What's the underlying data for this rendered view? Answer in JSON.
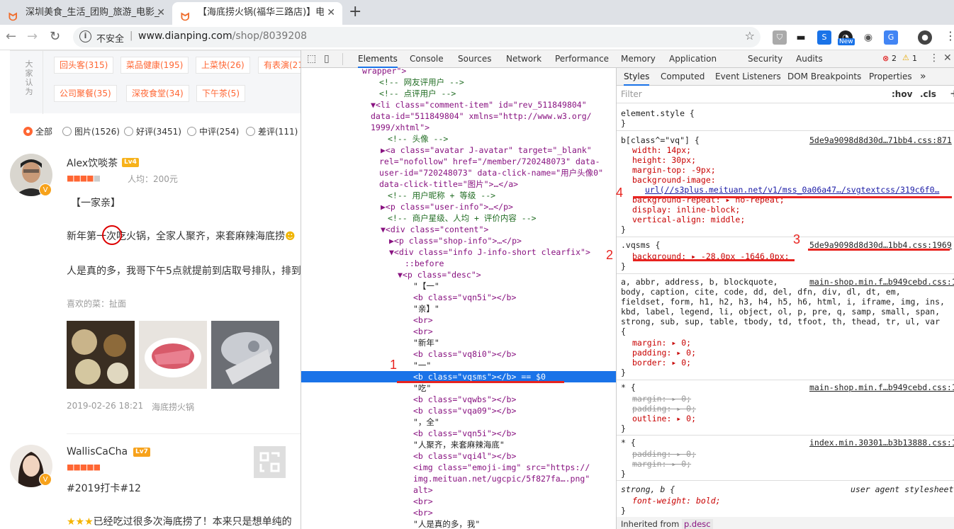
{
  "tabs": [
    {
      "title": "深圳美食_生活_团购_旅游_电影_",
      "active": false
    },
    {
      "title": "【海底捞火锅(福华三路店)】电话",
      "active": true
    }
  ],
  "address": {
    "security": "不安全",
    "host": "www.dianping.com",
    "path": "/shop/8039208"
  },
  "ext_badge": "New",
  "page": {
    "tag_label": "大家认为",
    "tags": [
      "回头客(315)",
      "菜品健康(195)",
      "上菜快(26)",
      "有表演(21",
      "公司聚餐(35)",
      "深夜食堂(34)",
      "下午茶(5)"
    ],
    "filters": [
      "全部",
      "图片(1526)",
      "好评(3451)",
      "中评(254)",
      "差评(111)"
    ],
    "review1": {
      "user": "Alex饮啖茶",
      "level": "Lv4",
      "avg": "人均：200元",
      "title": "【一家亲】",
      "line1a": "新年第一",
      "line1b": "次",
      "line1c": "吃火锅，全家人聚齐，来套麻辣海底捞",
      "line2": "人是真的多，我哥下午5点就提前到店取号排队，排到",
      "likes": "喜欢的菜：扯面",
      "date": "2019-02-26 18:21",
      "shop": "海底捞火锅"
    },
    "review2": {
      "user": "WallisCaCha",
      "level": "Lv7",
      "title": "#2019打卡#12",
      "line1": "已经吃过很多次海底捞了！本来只是想单纯的"
    }
  },
  "devtools": {
    "tabs": [
      "Elements",
      "Console",
      "Sources",
      "Network",
      "Performance",
      "Memory",
      "Application",
      "Security",
      "Audits"
    ],
    "errors": "2",
    "warnings": "1",
    "style_tabs": [
      "Styles",
      "Computed",
      "Event Listeners",
      "DOM Breakpoints",
      "Properties"
    ],
    "filter_placeholder": "Filter",
    "hov": ":hov",
    "cls": ".cls",
    "dom": [
      [
        "wrapper\">",
        ""
      ],
      [
        "<!-- 网友评用户 -->",
        "c"
      ],
      [
        "<!-- 点评用户 -->",
        "c"
      ],
      [
        "▼<li class=\"comment-item\" id=\"rev_511849804\"",
        ""
      ],
      [
        "data-id=\"511849804\" xmlns=\"http://www.w3.org/",
        ""
      ],
      [
        "1999/xhtml\">",
        ""
      ],
      [
        "<!-- 头像 -->",
        "c"
      ],
      [
        "▶<a class=\"avatar J-avatar\" target=\"_blank\"",
        ""
      ],
      [
        "rel=\"nofollow\" href=\"/member/720248073\" data-",
        ""
      ],
      [
        "user-id=\"720248073\" data-click-name=\"用户头像0\"",
        ""
      ],
      [
        "data-click-title=\"图片\">…</a>",
        ""
      ],
      [
        "<!-- 用户昵称 + 等级 -->",
        "c"
      ],
      [
        "▶<p class=\"user-info\">…</p>",
        ""
      ],
      [
        "<!-- 商户星级、人均 + 评价内容 -->",
        "c"
      ],
      [
        "▼<div class=\"content\">",
        ""
      ],
      [
        "▶<p class=\"shop-info\">…</p>",
        ""
      ],
      [
        "▼<div class=\"info J-info-short clearfix\">",
        ""
      ],
      [
        "::before",
        ""
      ],
      [
        "▼<p class=\"desc\">",
        ""
      ],
      [
        "\"【一\"",
        "t"
      ],
      [
        "<b class=\"vqn5i\"></b>",
        ""
      ],
      [
        "\"亲】\"",
        "t"
      ],
      [
        "<br>",
        ""
      ],
      [
        "<br>",
        ""
      ],
      [
        "\"新年\"",
        "t"
      ],
      [
        "<b class=\"vq8i0\"></b>",
        ""
      ],
      [
        "\"一\"",
        "t"
      ],
      [
        "<b class=\"vqsms\"></b> == $0",
        "s"
      ],
      [
        "\"吃\"",
        "t"
      ],
      [
        "<b class=\"vqwbs\"></b>",
        ""
      ],
      [
        "<b class=\"vqa09\"></b>",
        ""
      ],
      [
        "\"，全\"",
        "t"
      ],
      [
        "<b class=\"vqn5i\"></b>",
        ""
      ],
      [
        "\"人聚齐，来套麻辣海底\"",
        "t"
      ],
      [
        "<b class=\"vqi4l\"></b>",
        ""
      ],
      [
        "<img class=\"emoji-img\" src=\"https://",
        ""
      ],
      [
        "img.meituan.net/ugcpic/5f827fa….png\"",
        ""
      ],
      [
        "alt>",
        ""
      ],
      [
        "<br>",
        ""
      ],
      [
        "<br>",
        ""
      ],
      [
        "\"人是真的多，我\"",
        "t"
      ]
    ],
    "styles": {
      "element_style": "element.style {",
      "rule1_selector": "b[class^=\"vq\"] {",
      "rule1_src": "5de9a9098d8d30d…71bb4.css:871",
      "rule1_props": [
        "width: 14px;",
        "height: 30px;",
        "margin-top: -9px;",
        "background-image:",
        "url(//s3plus.meituan.net/v1/mss_0a06a47…/svgtextcss/319c6f0…",
        "background-repeat: ▸ no-repeat;",
        "display: inline-block;",
        "vertical-align: middle;"
      ],
      "rule2_selector": ".vqsms {",
      "rule2_src": "5de9a9098d8d30d…1bb4.css:1969",
      "rule2_prop": "background: ▸ -28.0px -1646.0px;",
      "rule3_selector": "a, abbr, address, b, blockquote,",
      "rule3_src": "main-shop.min.f…b949cebd.css:1",
      "rule3_lines": [
        "body, caption, cite, code, dd, del, dfn, div, dl, dt, em,",
        "fieldset, form, h1, h2, h3, h4, h5, h6, html, i, iframe, img, ins,",
        "kbd, label, legend, li, object, ol, p, pre, q, samp, small, span,",
        "strong, sub, sup, table, tbody, td, tfoot, th, thead, tr, ul, var",
        "{"
      ],
      "rule3_props": [
        "margin: ▸ 0;",
        "padding: ▸ 0;",
        "border: ▸ 0;"
      ],
      "rule4_selector": "* {",
      "rule4_src": "main-shop.min.f…b949cebd.css:1",
      "rule4_props": [
        "margin: ▸ 0;",
        "padding: ▸ 0;",
        "outline: ▸ 0;"
      ],
      "rule5_selector": "* {",
      "rule5_src": "index.min.30301…b3b13888.css:1",
      "rule5_props": [
        "padding: ▸ 0;",
        "margin: ▸ 0;"
      ],
      "rule6_selector": "strong, b {",
      "rule6_src": "user agent stylesheet",
      "rule6_prop": "font-weight: bold;",
      "inherited": "Inherited from",
      "inherited_el": "p.desc"
    },
    "annotations": [
      "1",
      "2",
      "3",
      "4"
    ]
  }
}
